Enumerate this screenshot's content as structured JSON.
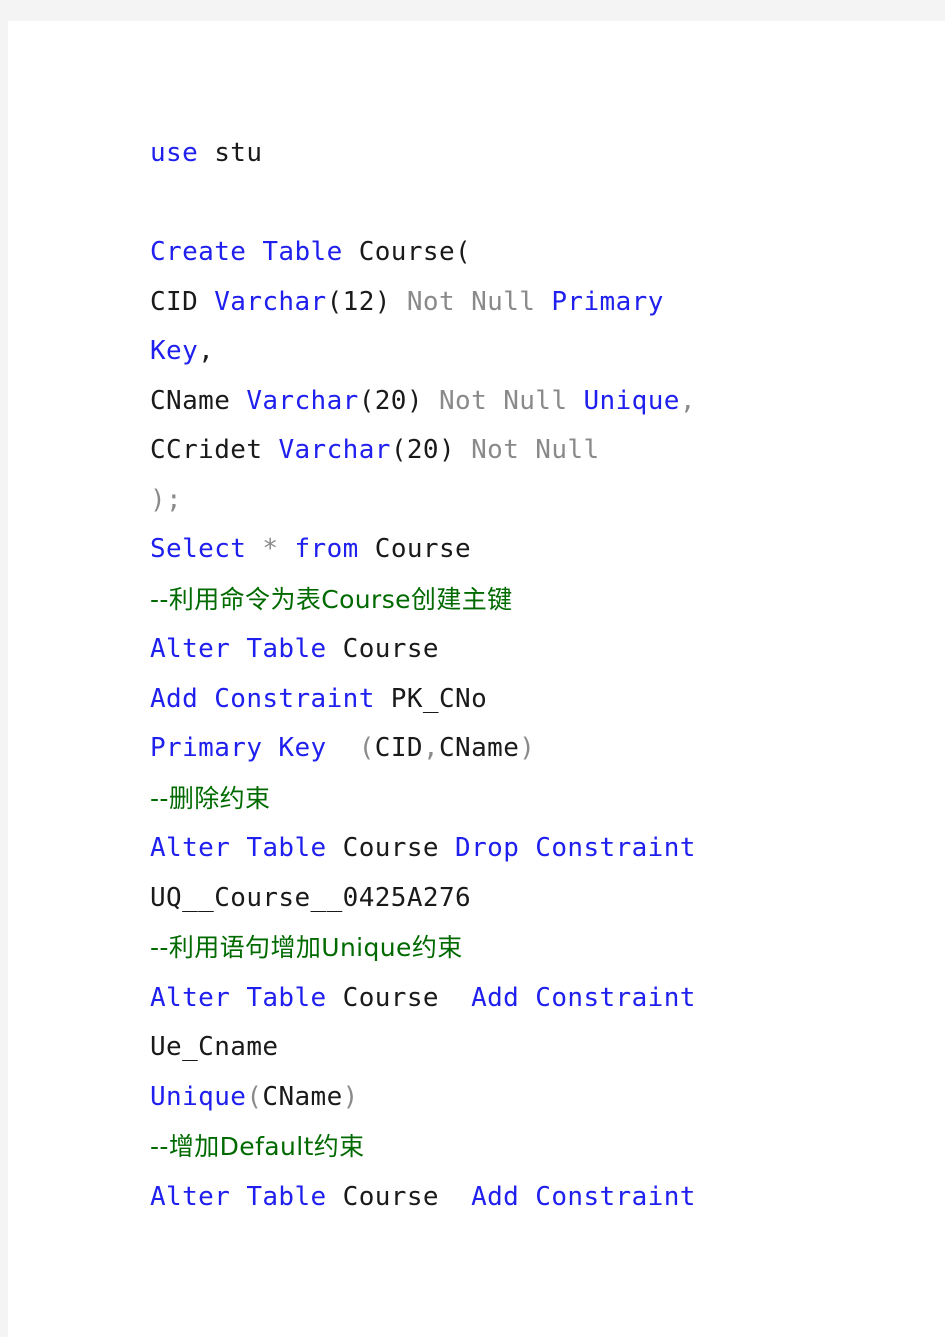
{
  "document": {
    "kind": "sql-script",
    "page_background": "#f4f4f4",
    "sheet_background": "#ffffff",
    "colors": {
      "keyword": "#2020ee",
      "modifier": "#8a8a8a",
      "identifier": "#1a1a1a",
      "comment": "#006a00"
    }
  },
  "code": {
    "lines": [
      {
        "index": 0,
        "plain": "use stu",
        "tokens": [
          {
            "text": "use",
            "kind": "kw"
          },
          {
            "text": " stu",
            "kind": "id"
          }
        ]
      },
      {
        "index": 1,
        "plain": "",
        "tokens": []
      },
      {
        "index": 2,
        "plain": "Create Table Course(",
        "tokens": [
          {
            "text": "Create Table",
            "kind": "kw"
          },
          {
            "text": " Course",
            "kind": "id"
          },
          {
            "text": "(",
            "kind": "punc"
          }
        ]
      },
      {
        "index": 3,
        "plain": "CID Varchar(12) Not Null Primary",
        "tokens": [
          {
            "text": "CID ",
            "kind": "id"
          },
          {
            "text": "Varchar",
            "kind": "kw"
          },
          {
            "text": "(12) ",
            "kind": "punc"
          },
          {
            "text": "Not Null",
            "kind": "mod"
          },
          {
            "text": " ",
            "kind": "id"
          },
          {
            "text": "Primary",
            "kind": "kw"
          }
        ]
      },
      {
        "index": 4,
        "plain": "Key,",
        "tokens": [
          {
            "text": "Key",
            "kind": "kw"
          },
          {
            "text": ",",
            "kind": "punc"
          }
        ]
      },
      {
        "index": 5,
        "plain": "CName Varchar(20) Not Null Unique,",
        "tokens": [
          {
            "text": "CName ",
            "kind": "id"
          },
          {
            "text": "Varchar",
            "kind": "kw"
          },
          {
            "text": "(20) ",
            "kind": "punc"
          },
          {
            "text": "Not Null",
            "kind": "mod"
          },
          {
            "text": " ",
            "kind": "id"
          },
          {
            "text": "Unique",
            "kind": "kw"
          },
          {
            "text": ",",
            "kind": "mod"
          }
        ]
      },
      {
        "index": 6,
        "plain": "CCridet Varchar(20) Not Null",
        "tokens": [
          {
            "text": "CCridet ",
            "kind": "id"
          },
          {
            "text": "Varchar",
            "kind": "kw"
          },
          {
            "text": "(20) ",
            "kind": "punc"
          },
          {
            "text": "Not Null",
            "kind": "mod"
          }
        ]
      },
      {
        "index": 7,
        "plain": ");",
        "tokens": [
          {
            "text": ");",
            "kind": "mod"
          }
        ]
      },
      {
        "index": 8,
        "plain": "Select * from Course",
        "tokens": [
          {
            "text": "Select",
            "kind": "kw"
          },
          {
            "text": " * ",
            "kind": "mod"
          },
          {
            "text": "from",
            "kind": "kw"
          },
          {
            "text": " Course",
            "kind": "id"
          }
        ]
      },
      {
        "index": 9,
        "plain": "--利用命令为表Course创建主键",
        "tokens": [
          {
            "text": "--利用命令为表Course创建主键",
            "kind": "cmt"
          }
        ]
      },
      {
        "index": 10,
        "plain": "Alter Table Course",
        "tokens": [
          {
            "text": "Alter Table",
            "kind": "kw"
          },
          {
            "text": " Course",
            "kind": "id"
          }
        ]
      },
      {
        "index": 11,
        "plain": "Add Constraint PK_CNo",
        "tokens": [
          {
            "text": "Add Constraint",
            "kind": "kw"
          },
          {
            "text": " PK_CNo",
            "kind": "id"
          }
        ]
      },
      {
        "index": 12,
        "plain": "Primary Key  (CID,CName)",
        "tokens": [
          {
            "text": "Primary Key",
            "kind": "kw"
          },
          {
            "text": "  (",
            "kind": "mod"
          },
          {
            "text": "CID",
            "kind": "id"
          },
          {
            "text": ",",
            "kind": "mod"
          },
          {
            "text": "CName",
            "kind": "id"
          },
          {
            "text": ")",
            "kind": "mod"
          }
        ]
      },
      {
        "index": 13,
        "plain": "--删除约束",
        "tokens": [
          {
            "text": "--删除约束",
            "kind": "cmt"
          }
        ]
      },
      {
        "index": 14,
        "plain": "Alter Table Course Drop Constraint",
        "tokens": [
          {
            "text": "Alter Table",
            "kind": "kw"
          },
          {
            "text": " Course ",
            "kind": "id"
          },
          {
            "text": "Drop Constraint",
            "kind": "kw"
          }
        ]
      },
      {
        "index": 15,
        "plain": "UQ__Course__0425A276",
        "tokens": [
          {
            "text": "UQ__Course__0425A276",
            "kind": "id"
          }
        ]
      },
      {
        "index": 16,
        "plain": "--利用语句增加Unique约束",
        "tokens": [
          {
            "text": "--利用语句增加Unique约束",
            "kind": "cmt"
          }
        ]
      },
      {
        "index": 17,
        "plain": "Alter Table Course Add Constraint",
        "tokens": [
          {
            "text": "Alter Table",
            "kind": "kw"
          },
          {
            "text": " Course  ",
            "kind": "id"
          },
          {
            "text": "Add Constraint",
            "kind": "kw"
          }
        ]
      },
      {
        "index": 18,
        "plain": "Ue_Cname",
        "tokens": [
          {
            "text": "Ue_Cname",
            "kind": "id"
          }
        ]
      },
      {
        "index": 19,
        "plain": "Unique(CName)",
        "tokens": [
          {
            "text": "Unique",
            "kind": "kw"
          },
          {
            "text": "(",
            "kind": "mod"
          },
          {
            "text": "CName",
            "kind": "id"
          },
          {
            "text": ")",
            "kind": "mod"
          }
        ]
      },
      {
        "index": 20,
        "plain": "--增加Default约束",
        "tokens": [
          {
            "text": "--增加Default约束",
            "kind": "cmt"
          }
        ]
      },
      {
        "index": 21,
        "plain": "Alter Table Course Add Constraint",
        "tokens": [
          {
            "text": "Alter Table",
            "kind": "kw"
          },
          {
            "text": " Course  ",
            "kind": "id"
          },
          {
            "text": "Add Constraint",
            "kind": "kw"
          }
        ]
      }
    ]
  }
}
